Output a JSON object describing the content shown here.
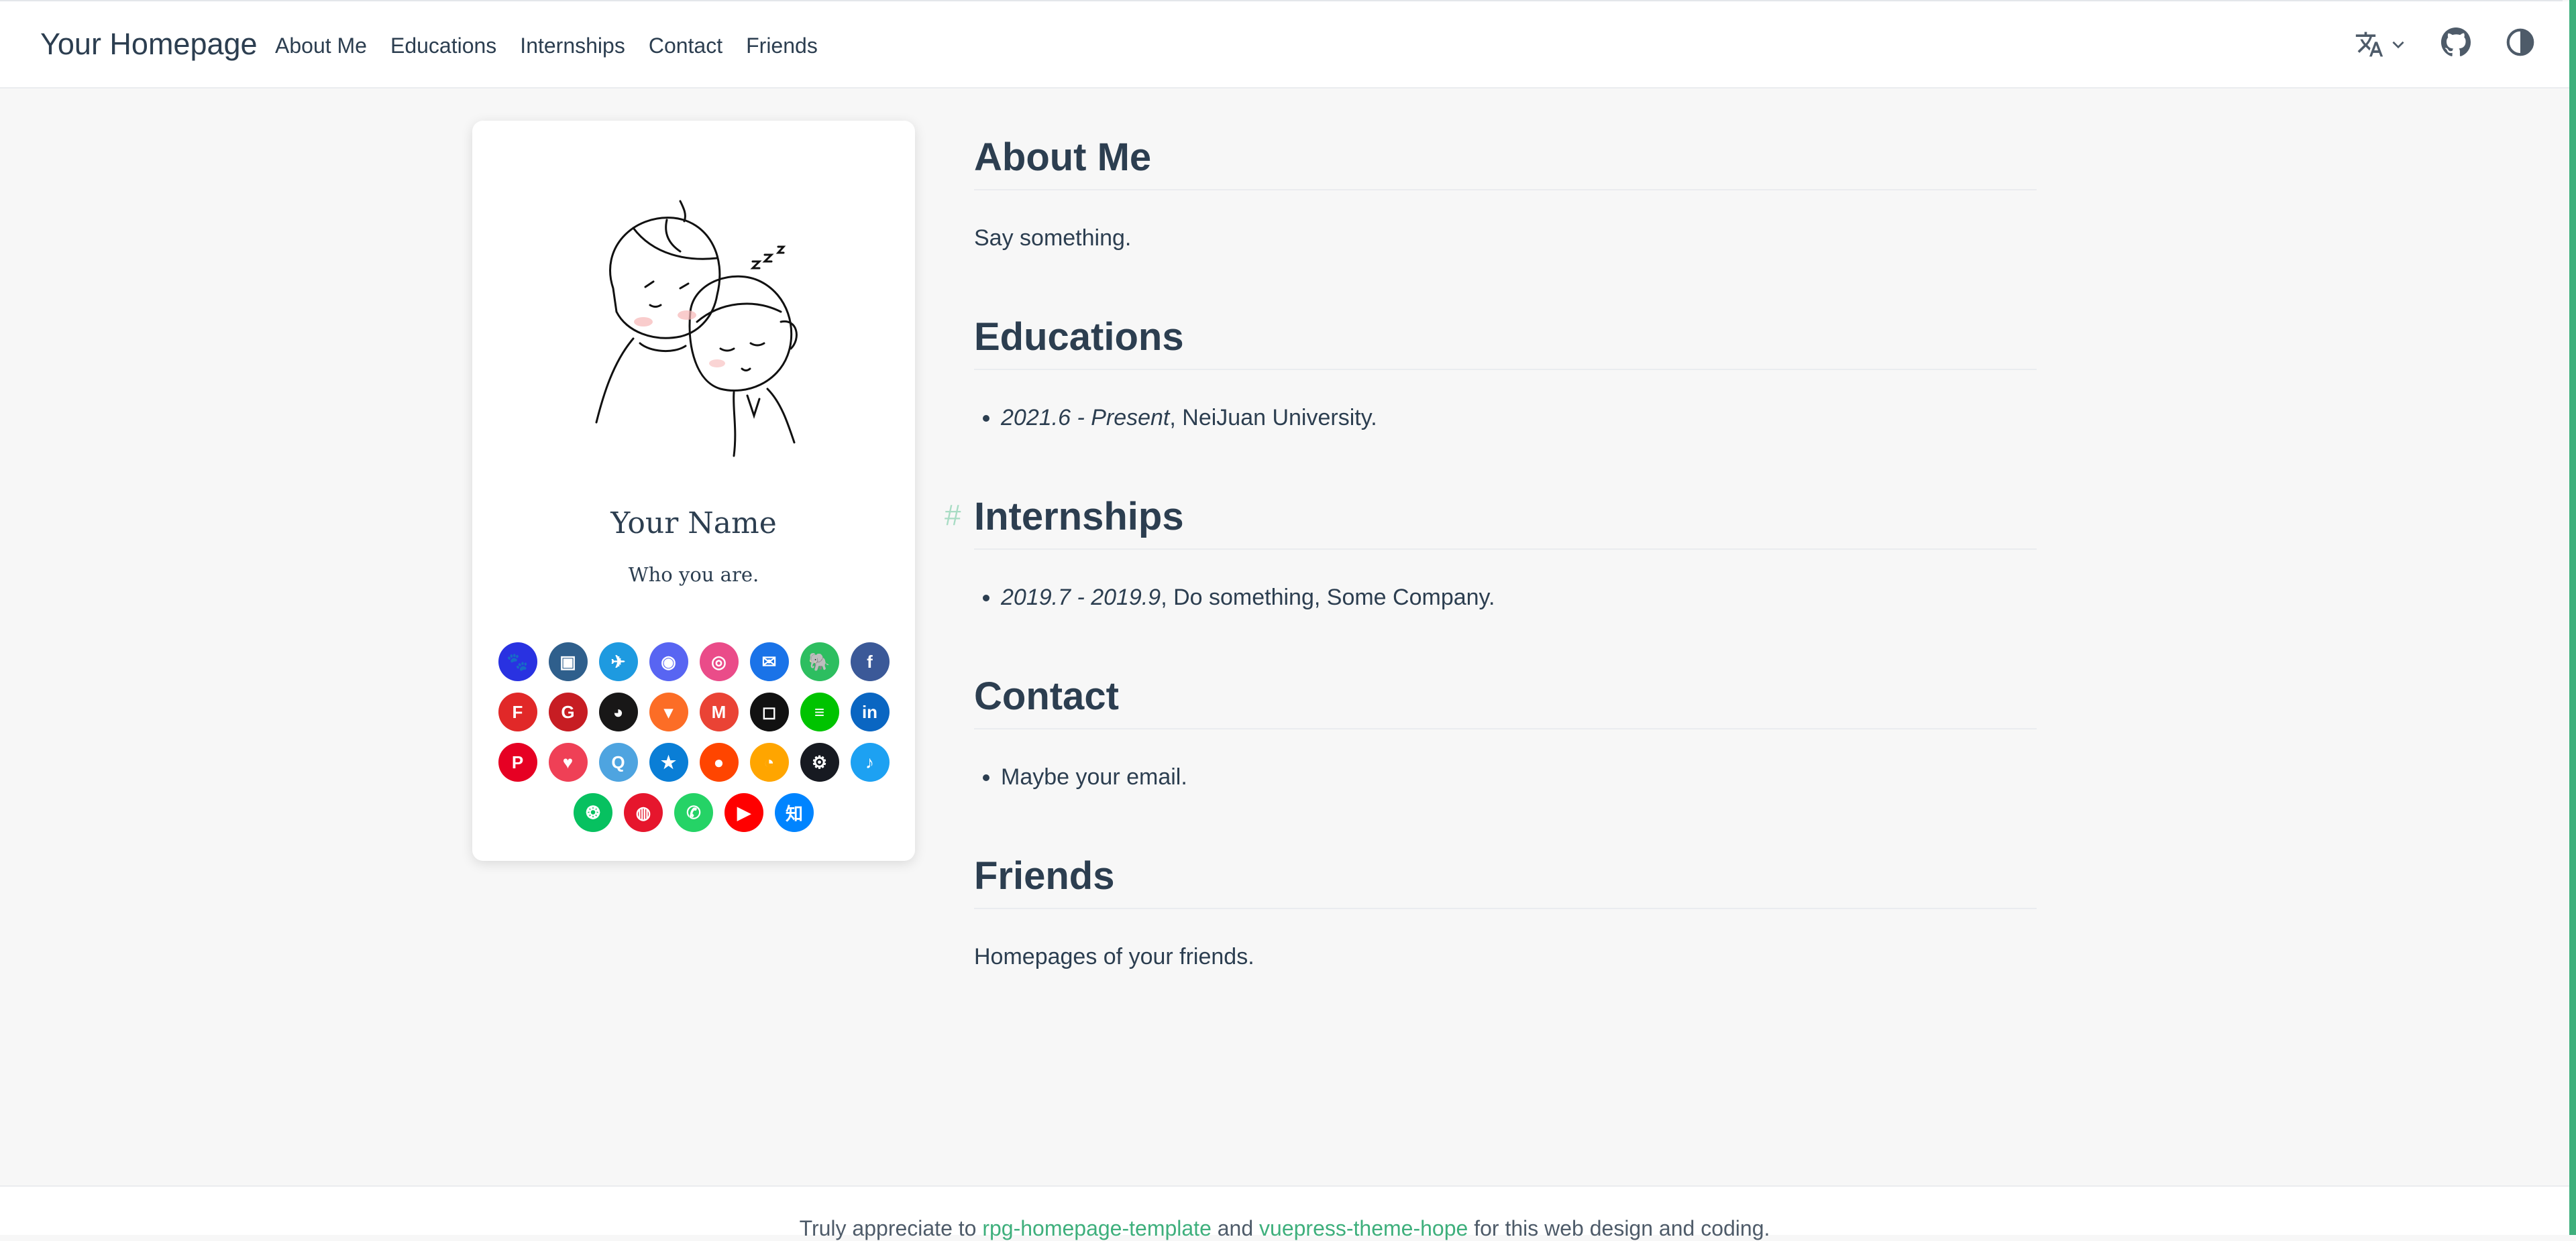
{
  "navbar": {
    "brand": "Your Homepage",
    "links": [
      "About Me",
      "Educations",
      "Internships",
      "Contact",
      "Friends"
    ],
    "icons": [
      "translate-icon",
      "chevron-down-icon",
      "github-icon",
      "theme-toggle-icon"
    ]
  },
  "profile": {
    "name": "Your Name",
    "tagline": "Who you are.",
    "socials": [
      {
        "name": "baidu",
        "color": "#2932e1",
        "glyph": "🐾"
      },
      {
        "name": "bilibili",
        "color": "#2f5f8c",
        "glyph": "▣"
      },
      {
        "name": "feishu",
        "color": "#1e9ae0",
        "glyph": "✈"
      },
      {
        "name": "discord",
        "color": "#5865f2",
        "glyph": "◉"
      },
      {
        "name": "dribbble",
        "color": "#ea4c89",
        "glyph": "◎"
      },
      {
        "name": "email",
        "color": "#1a73e8",
        "glyph": "✉"
      },
      {
        "name": "evernote",
        "color": "#2dbe60",
        "glyph": "🐘"
      },
      {
        "name": "facebook",
        "color": "#3b5998",
        "glyph": "f"
      },
      {
        "name": "flipboard",
        "color": "#e12828",
        "glyph": "F"
      },
      {
        "name": "gitee",
        "color": "#c71d23",
        "glyph": "G"
      },
      {
        "name": "github",
        "color": "#181717",
        "glyph": "◕"
      },
      {
        "name": "gitlab",
        "color": "#fc6d26",
        "glyph": "▾"
      },
      {
        "name": "gmail",
        "color": "#ea4335",
        "glyph": "M"
      },
      {
        "name": "instagram",
        "color": "#111111",
        "glyph": "◻"
      },
      {
        "name": "line",
        "color": "#00c300",
        "glyph": "≡"
      },
      {
        "name": "linkedin",
        "color": "#0a66c2",
        "glyph": "in"
      },
      {
        "name": "pinterest",
        "color": "#e60023",
        "glyph": "P"
      },
      {
        "name": "pocket",
        "color": "#ef4056",
        "glyph": "♥"
      },
      {
        "name": "qq",
        "color": "#4ea4e0",
        "glyph": "Q"
      },
      {
        "name": "qzone",
        "color": "#0a7ed6",
        "glyph": "★"
      },
      {
        "name": "reddit",
        "color": "#ff4500",
        "glyph": "●"
      },
      {
        "name": "rss",
        "color": "#ffa500",
        "glyph": "◔"
      },
      {
        "name": "steam",
        "color": "#171a21",
        "glyph": "⚙"
      },
      {
        "name": "twitter",
        "color": "#1da1f2",
        "glyph": "♪"
      },
      {
        "name": "wechat",
        "color": "#07c160",
        "glyph": "❂"
      },
      {
        "name": "weibo",
        "color": "#e6162d",
        "glyph": "◍"
      },
      {
        "name": "whatsapp",
        "color": "#25d366",
        "glyph": "✆"
      },
      {
        "name": "youtube",
        "color": "#ff0000",
        "glyph": "▶"
      },
      {
        "name": "zhihu",
        "color": "#0084ff",
        "glyph": "知"
      }
    ]
  },
  "sections": {
    "about": {
      "title": "About Me",
      "text": "Say something."
    },
    "educations": {
      "title": "Educations",
      "date": "2021.6 - Present",
      "rest": ", NeiJuan University."
    },
    "internships": {
      "title": "Internships",
      "anchor": "#",
      "date": "2019.7 - 2019.9",
      "rest": ", Do something, Some Company."
    },
    "contact": {
      "title": "Contact",
      "item": "Maybe your email."
    },
    "friends": {
      "title": "Friends",
      "text": "Homepages of your friends."
    }
  },
  "footer": {
    "prefix": "Truly appreciate to ",
    "link1": "rpg-homepage-template",
    "mid": " and ",
    "link2": "vuepress-theme-hope",
    "suffix": " for this web design and coding."
  },
  "colors": {
    "accent": "#3eaf7c",
    "text": "#2c3e50",
    "background": "#f7f7f7"
  }
}
